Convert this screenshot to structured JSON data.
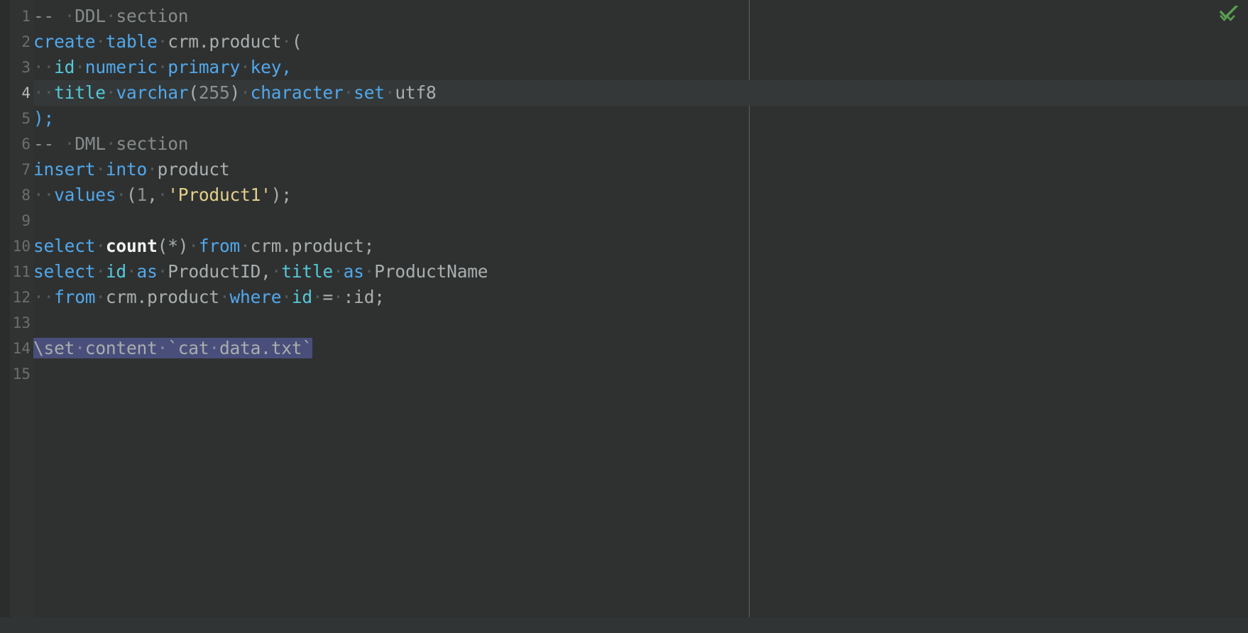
{
  "editor": {
    "app": "sql-code-editor",
    "language": "SQL",
    "current_line": 4,
    "total_lines": 15,
    "font_size_px": 24,
    "right_margin_column_guide": true,
    "whitespace_dot": "·",
    "colors": {
      "background": "#2f3131",
      "gutter_background": "#313333",
      "current_line_highlight": "#343838",
      "selection": "#4a4e7a",
      "keyword": "#51a8ec",
      "identifier": "#a9aeae",
      "column": "#56c8d8",
      "function": "#f2f2f2",
      "string": "#e4d08a",
      "number": "#8a8f8f",
      "comment": "#868b8b",
      "line_number": "#6b6f6f",
      "line_number_current": "#b6bbbb",
      "inspection_ok": "#5a9e4f",
      "margin_guide": "#5b5f5f"
    },
    "line_numbers": [
      "1",
      "2",
      "3",
      "4",
      "5",
      "6",
      "7",
      "8",
      "9",
      "10",
      "11",
      "12",
      "13",
      "14",
      "15"
    ],
    "lines": [
      {
        "n": 1,
        "text": "-- DDL section",
        "tokens": [
          {
            "t": "-- ",
            "c": "cmt"
          },
          {
            "t": "·",
            "c": "ws"
          },
          {
            "t": "DDL",
            "c": "cmt"
          },
          {
            "t": "·",
            "c": "ws"
          },
          {
            "t": "section",
            "c": "cmt"
          }
        ]
      },
      {
        "n": 2,
        "text": "create table crm.product (",
        "tokens": [
          {
            "t": "create",
            "c": "kw"
          },
          {
            "t": "·",
            "c": "ws"
          },
          {
            "t": "table",
            "c": "kw"
          },
          {
            "t": "·",
            "c": "ws"
          },
          {
            "t": "crm.product",
            "c": "ident"
          },
          {
            "t": "·",
            "c": "ws"
          },
          {
            "t": "(",
            "c": "punc"
          }
        ]
      },
      {
        "n": 3,
        "text": "  id numeric primary key,",
        "tokens": [
          {
            "t": "··",
            "c": "ws"
          },
          {
            "t": "id",
            "c": "col"
          },
          {
            "t": "·",
            "c": "ws"
          },
          {
            "t": "numeric",
            "c": "kw"
          },
          {
            "t": "·",
            "c": "ws"
          },
          {
            "t": "primary",
            "c": "kw"
          },
          {
            "t": "·",
            "c": "ws"
          },
          {
            "t": "key",
            "c": "kw"
          },
          {
            "t": ",",
            "c": "kw"
          }
        ]
      },
      {
        "n": 4,
        "text": "  title varchar(255) character set utf8",
        "current": true,
        "tokens": [
          {
            "t": "··",
            "c": "ws"
          },
          {
            "t": "title",
            "c": "col"
          },
          {
            "t": "·",
            "c": "ws"
          },
          {
            "t": "varchar",
            "c": "kw"
          },
          {
            "t": "(",
            "c": "punc"
          },
          {
            "t": "255",
            "c": "num"
          },
          {
            "t": ")",
            "c": "punc"
          },
          {
            "t": "·",
            "c": "ws"
          },
          {
            "t": "character",
            "c": "kw"
          },
          {
            "t": "·",
            "c": "ws"
          },
          {
            "t": "set",
            "c": "kw"
          },
          {
            "t": "·",
            "c": "ws"
          },
          {
            "t": "utf8",
            "c": "ident"
          }
        ]
      },
      {
        "n": 5,
        "text": ");",
        "tokens": [
          {
            "t": ");",
            "c": "kw"
          }
        ]
      },
      {
        "n": 6,
        "text": "-- DML section",
        "tokens": [
          {
            "t": "-- ",
            "c": "cmt"
          },
          {
            "t": "·",
            "c": "ws"
          },
          {
            "t": "DML",
            "c": "cmt"
          },
          {
            "t": "·",
            "c": "ws"
          },
          {
            "t": "section",
            "c": "cmt"
          }
        ]
      },
      {
        "n": 7,
        "text": "insert into product",
        "tokens": [
          {
            "t": "insert",
            "c": "kw"
          },
          {
            "t": "·",
            "c": "ws"
          },
          {
            "t": "into",
            "c": "kw"
          },
          {
            "t": "·",
            "c": "ws"
          },
          {
            "t": "product",
            "c": "ident"
          }
        ]
      },
      {
        "n": 8,
        "text": "  values (1, 'Product1');",
        "tokens": [
          {
            "t": "··",
            "c": "ws"
          },
          {
            "t": "values",
            "c": "kw"
          },
          {
            "t": "·",
            "c": "ws"
          },
          {
            "t": "(",
            "c": "punc"
          },
          {
            "t": "1",
            "c": "num"
          },
          {
            "t": ",",
            "c": "punc"
          },
          {
            "t": "·",
            "c": "ws"
          },
          {
            "t": "'Product1'",
            "c": "str"
          },
          {
            "t": ");",
            "c": "punc"
          }
        ]
      },
      {
        "n": 9,
        "text": "",
        "tokens": []
      },
      {
        "n": 10,
        "text": "select count(*) from crm.product;",
        "tokens": [
          {
            "t": "select",
            "c": "kw"
          },
          {
            "t": "·",
            "c": "ws"
          },
          {
            "t": "count",
            "c": "fn"
          },
          {
            "t": "(*)",
            "c": "punc"
          },
          {
            "t": "·",
            "c": "ws"
          },
          {
            "t": "from",
            "c": "kw"
          },
          {
            "t": "·",
            "c": "ws"
          },
          {
            "t": "crm.product;",
            "c": "ident"
          }
        ]
      },
      {
        "n": 11,
        "text": "select id as ProductID, title as ProductName",
        "tokens": [
          {
            "t": "select",
            "c": "kw"
          },
          {
            "t": "·",
            "c": "ws"
          },
          {
            "t": "id",
            "c": "col"
          },
          {
            "t": "·",
            "c": "ws"
          },
          {
            "t": "as",
            "c": "kw"
          },
          {
            "t": "·",
            "c": "ws"
          },
          {
            "t": "ProductID,",
            "c": "ident"
          },
          {
            "t": "·",
            "c": "ws"
          },
          {
            "t": "title",
            "c": "col"
          },
          {
            "t": "·",
            "c": "ws"
          },
          {
            "t": "as",
            "c": "kw"
          },
          {
            "t": "·",
            "c": "ws"
          },
          {
            "t": "ProductName",
            "c": "ident"
          }
        ]
      },
      {
        "n": 12,
        "text": "  from crm.product where id = :id;",
        "tokens": [
          {
            "t": "··",
            "c": "ws"
          },
          {
            "t": "from",
            "c": "kw"
          },
          {
            "t": "·",
            "c": "ws"
          },
          {
            "t": "crm.product",
            "c": "ident"
          },
          {
            "t": "·",
            "c": "ws"
          },
          {
            "t": "where",
            "c": "kw"
          },
          {
            "t": "·",
            "c": "ws"
          },
          {
            "t": "id",
            "c": "col"
          },
          {
            "t": "·",
            "c": "ws"
          },
          {
            "t": "=",
            "c": "punc"
          },
          {
            "t": "·",
            "c": "ws"
          },
          {
            "t": ":id;",
            "c": "ident"
          }
        ]
      },
      {
        "n": 13,
        "text": "",
        "tokens": []
      },
      {
        "n": 14,
        "text": "\\set content `cat data.txt`",
        "selected": true,
        "tokens": [
          {
            "t": "\\set",
            "c": "ident"
          },
          {
            "t": "·",
            "c": "ws"
          },
          {
            "t": "content",
            "c": "ident"
          },
          {
            "t": "·",
            "c": "ws"
          },
          {
            "t": "`cat",
            "c": "ident"
          },
          {
            "t": "·",
            "c": "ws"
          },
          {
            "t": "data.txt`",
            "c": "ident"
          }
        ]
      },
      {
        "n": 15,
        "text": "",
        "tokens": []
      }
    ],
    "inspection": {
      "icon": "double-check-icon",
      "status": "No problems found",
      "color": "#5a9e4f"
    }
  }
}
